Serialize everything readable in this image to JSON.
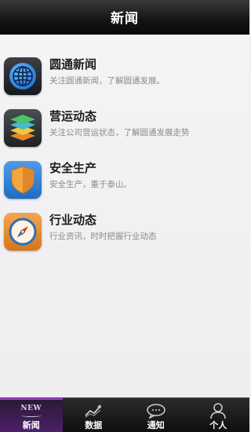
{
  "header": {
    "title": "新闻"
  },
  "menu": [
    {
      "label": "圆通新闻",
      "desc": "关注圆通新闻，了解圆通发展。",
      "icon": "globe-icon"
    },
    {
      "label": "营运动态",
      "desc": "关注公司营运状态，了解圆通发展走势",
      "icon": "layers-icon"
    },
    {
      "label": "安全生产",
      "desc": "安全生产，重于泰山。",
      "icon": "shield-icon"
    },
    {
      "label": "行业动态",
      "desc": "行业资讯，时时把握行业动态",
      "icon": "compass-icon"
    }
  ],
  "tabs": [
    {
      "label": "新闻",
      "badge": "NEW",
      "icon": "news-icon",
      "active": true
    },
    {
      "label": "数据",
      "icon": "chart-icon",
      "active": false
    },
    {
      "label": "通知",
      "icon": "speech-bubble-icon",
      "active": false
    },
    {
      "label": "个人",
      "icon": "user-icon",
      "active": false
    }
  ],
  "colors": {
    "tab_active": "#a53ad8",
    "header_bg": "#141414"
  }
}
